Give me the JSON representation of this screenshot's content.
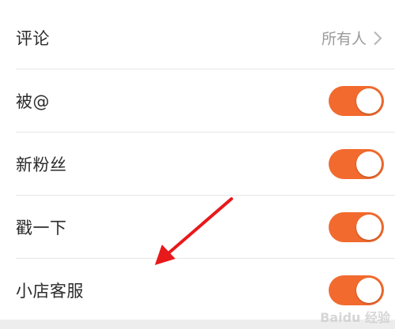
{
  "settings": {
    "rows": [
      {
        "label": "评论",
        "value": "所有人",
        "control": "chevron"
      },
      {
        "label": "被@",
        "control": "toggle",
        "on": true
      },
      {
        "label": "新粉丝",
        "control": "toggle",
        "on": true
      },
      {
        "label": "戳一下",
        "control": "toggle",
        "on": true
      },
      {
        "label": "小店客服",
        "control": "toggle",
        "on": true
      }
    ]
  },
  "colors": {
    "toggle_on": "#f26a2e",
    "annotation_arrow": "#e8191b"
  },
  "icons": {
    "chevron": "chevron-right-icon",
    "arrow": "red-annotation-arrow"
  },
  "watermark": "Baidu 经验"
}
